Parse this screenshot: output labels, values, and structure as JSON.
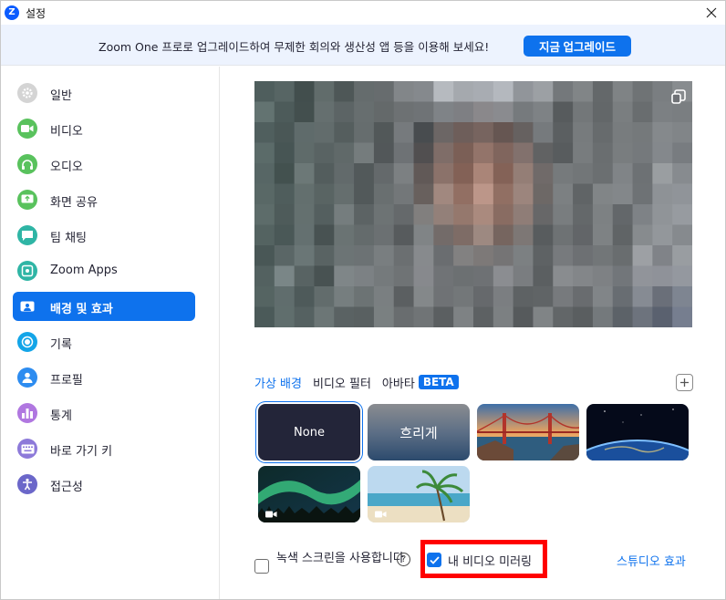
{
  "window": {
    "title": "설정"
  },
  "banner": {
    "text": "Zoom One 프로로 업그레이드하여 무제한 회의와 생산성 앱 등을 이용해 보세요!",
    "upgrade_label": "지금 업그레이드"
  },
  "sidebar": {
    "items": [
      {
        "label": "일반",
        "icon": "gear-icon",
        "color": "#c9c9c9"
      },
      {
        "label": "비디오",
        "icon": "video-camera-icon",
        "color": "#4fc24f"
      },
      {
        "label": "오디오",
        "icon": "headphones-icon",
        "color": "#4fc24f"
      },
      {
        "label": "화면 공유",
        "icon": "screen-share-icon",
        "color": "#4fc24f"
      },
      {
        "label": "팀 채팅",
        "icon": "chat-icon",
        "color": "#2fb5a5"
      },
      {
        "label": "Zoom Apps",
        "icon": "apps-icon",
        "color": "#2fb5a5"
      },
      {
        "label": "배경 및 효과",
        "icon": "background-icon",
        "color": "#ffffff"
      },
      {
        "label": "기록",
        "icon": "record-icon",
        "color": "#13a5e8"
      },
      {
        "label": "프로필",
        "icon": "profile-icon",
        "color": "#2d8cf0"
      },
      {
        "label": "통계",
        "icon": "statistics-icon",
        "color": "#a970e0"
      },
      {
        "label": "바로 가기 키",
        "icon": "keyboard-icon",
        "color": "#8d7ad9"
      },
      {
        "label": "접근성",
        "icon": "accessibility-icon",
        "color": "#6b67c9"
      }
    ],
    "active_index": 6
  },
  "tabs": {
    "items": [
      "가상 배경",
      "비디오 필터",
      "아바타"
    ],
    "active": "가상 배경",
    "badge": "BETA"
  },
  "backgrounds": {
    "tiles": [
      "None",
      "흐리게",
      "golden-gate-bridge",
      "earth-from-space",
      "aurora",
      "beach-palm"
    ],
    "selected": "None"
  },
  "options": {
    "green_screen_label": "녹색 스크린을 사용합니다",
    "green_screen_checked": false,
    "mirror_label": "내 비디오 미러링",
    "mirror_checked": true,
    "studio_effects_label": "스튜디오 효과"
  },
  "colors": {
    "accent": "#0e72ed",
    "highlight_box": "#ff0000"
  }
}
